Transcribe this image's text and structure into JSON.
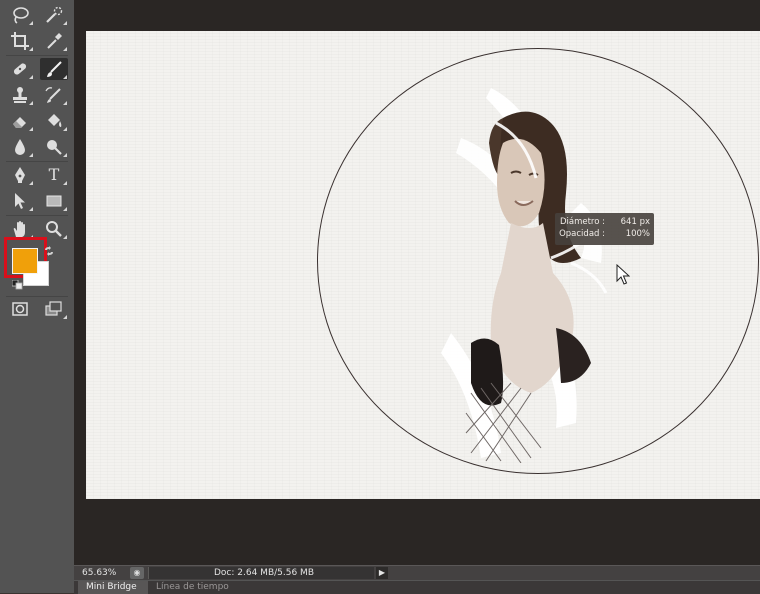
{
  "toolbar": {
    "tools": [
      {
        "name": "lasso-tool",
        "icon": "lasso-icon"
      },
      {
        "name": "quick-selection-tool",
        "icon": "quick-selection-icon"
      },
      {
        "name": "crop-tool",
        "icon": "crop-icon"
      },
      {
        "name": "eyedropper-tool",
        "icon": "eyedropper-icon"
      },
      {
        "name": "spot-healing-tool",
        "icon": "bandage-icon"
      },
      {
        "name": "brush-tool",
        "icon": "brush-icon",
        "active": true
      },
      {
        "name": "clone-stamp-tool",
        "icon": "stamp-icon"
      },
      {
        "name": "history-brush-tool",
        "icon": "history-brush-icon"
      },
      {
        "name": "eraser-tool",
        "icon": "eraser-icon"
      },
      {
        "name": "paint-bucket-tool",
        "icon": "bucket-icon"
      },
      {
        "name": "blur-tool",
        "icon": "drop-icon"
      },
      {
        "name": "dodge-tool",
        "icon": "dodge-icon"
      },
      {
        "name": "pen-tool",
        "icon": "pen-icon"
      },
      {
        "name": "type-tool",
        "icon": "type-icon",
        "glyph": "T"
      },
      {
        "name": "path-selection-tool",
        "icon": "arrow-icon"
      },
      {
        "name": "rectangle-tool",
        "icon": "rectangle-icon"
      },
      {
        "name": "hand-tool",
        "icon": "hand-icon"
      },
      {
        "name": "zoom-tool",
        "icon": "magnifier-icon"
      }
    ],
    "foreground_color": "#f0a00a",
    "background_color": "#ffffff",
    "highlight_color": "#d90f1b",
    "quick_mask": "quick-mask-icon",
    "screen_mode": "screen-mode-icon"
  },
  "tooltip": {
    "diameter_label": "Diámetro :",
    "diameter_value": "641 px",
    "opacity_label": "Opacidad :",
    "opacity_value": "100%"
  },
  "status": {
    "zoom": "65.63%",
    "doc": "Doc: 2.64 MB/5.56 MB"
  },
  "tabs": [
    "Mini Bridge",
    "Línea de tiempo"
  ]
}
